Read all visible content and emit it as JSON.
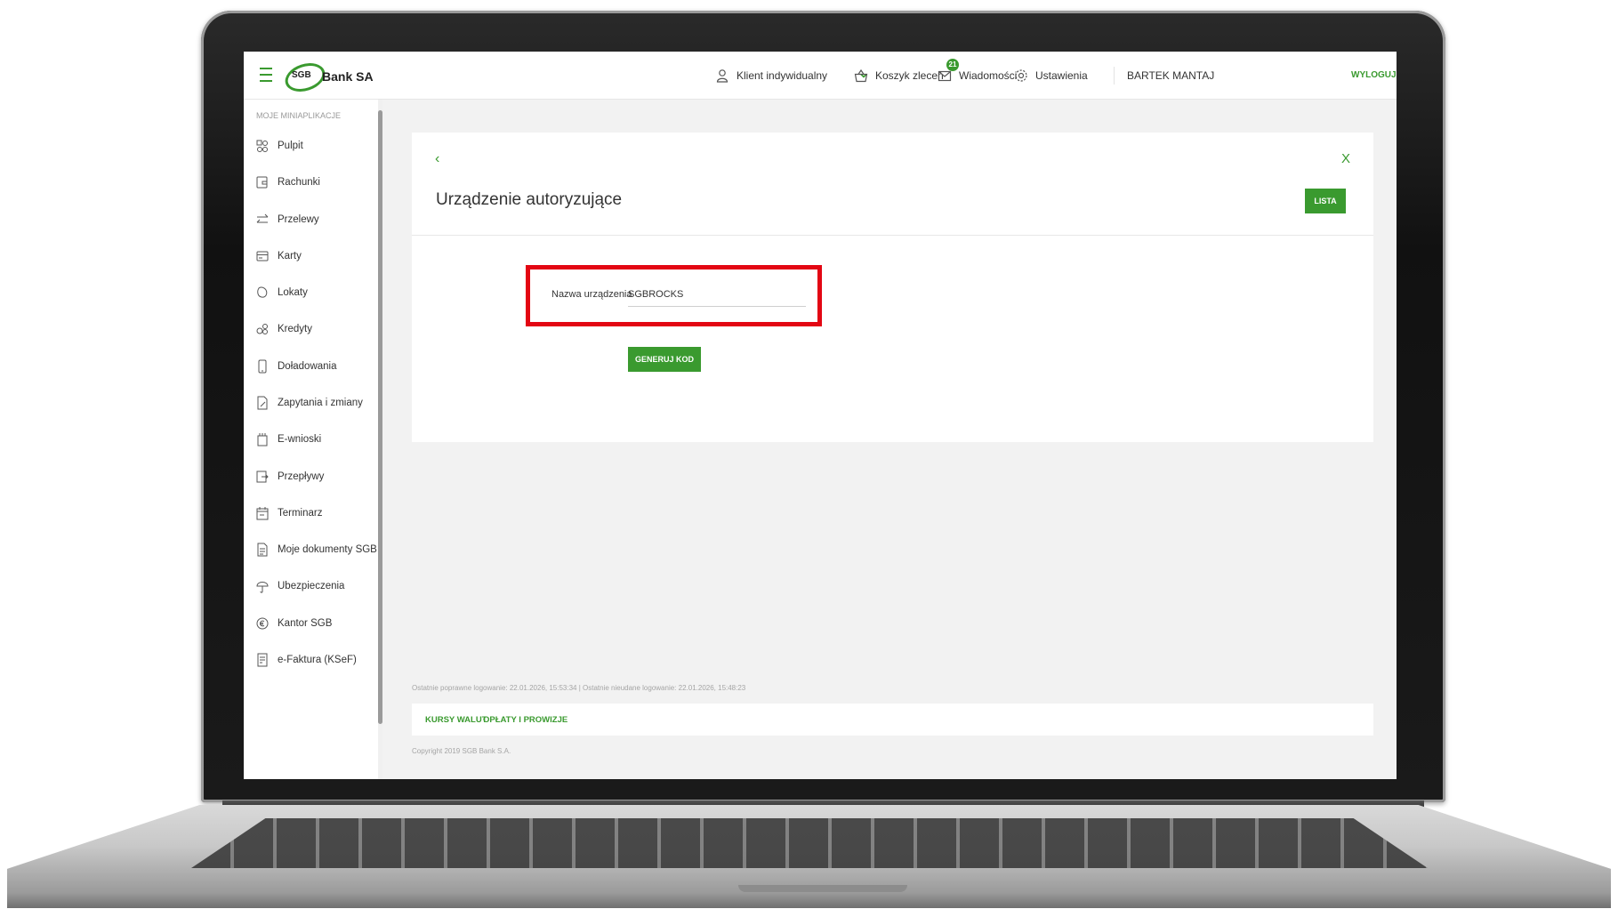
{
  "header": {
    "logo_mark": "SGB",
    "logo_text": "Bank SA",
    "client_type": "Klient indywidualny",
    "basket_label": "Koszyk zleceń",
    "messages_label": "Wiadomości",
    "messages_count": "21",
    "settings_label": "Ustawienia",
    "user_name": "BARTEK MANTAJ",
    "logout_label": "WYLOGUJ"
  },
  "sidebar": {
    "heading": "MOJE MINIAPLIKACJE",
    "items": [
      {
        "label": "Pulpit"
      },
      {
        "label": "Rachunki"
      },
      {
        "label": "Przelewy"
      },
      {
        "label": "Karty"
      },
      {
        "label": "Lokaty"
      },
      {
        "label": "Kredyty"
      },
      {
        "label": "Doładowania"
      },
      {
        "label": "Zapytania i zmiany"
      },
      {
        "label": "E-wnioski"
      },
      {
        "label": "Przepływy"
      },
      {
        "label": "Terminarz"
      },
      {
        "label": "Moje dokumenty SGB"
      },
      {
        "label": "Ubezpieczenia"
      },
      {
        "label": "Kantor SGB"
      },
      {
        "label": "e-Faktura (KSeF)"
      }
    ]
  },
  "main": {
    "back_glyph": "‹",
    "close_glyph": "X",
    "title": "Urządzenie autoryzujące",
    "list_button": "LISTA",
    "device_name_label": "Nazwa urządzenia",
    "device_name_value": "SGBROCKS",
    "generate_button": "GENERUJ KOD"
  },
  "footer": {
    "login_info": "Ostatnie poprawne logowanie: 22.01.2026, 15:53:34  |  Ostatnie nieudane logowanie: 22.01.2026, 15:48:23",
    "link_rates": "KURSY WALUT",
    "link_fees": "OPŁATY I PROWIZJE",
    "copyright": "Copyright 2019 SGB Bank S.A."
  },
  "colors": {
    "accent": "#3a9a2f",
    "highlight": "#e30613",
    "background": "#f2f2f2"
  }
}
